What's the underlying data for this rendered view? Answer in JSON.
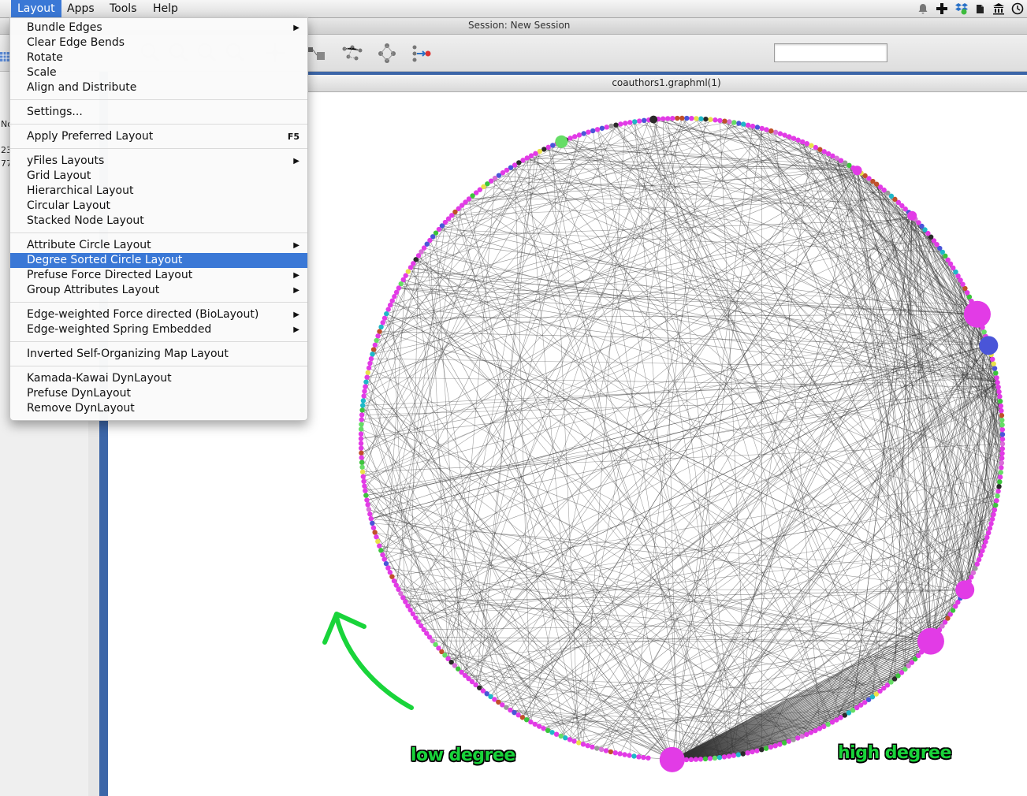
{
  "menubar": {
    "items": [
      "Layout",
      "Apps",
      "Tools",
      "Help"
    ],
    "active": "Layout",
    "tray_icons": [
      "bell-icon",
      "plus-cross-icon",
      "dropbox-icon",
      "evernote-icon",
      "museum-icon",
      "timemachine-icon"
    ]
  },
  "window": {
    "session_title": "Session: New Session",
    "network_title": "coauthors1.graphml(1)"
  },
  "left_panel": {
    "header_fragment": "No",
    "row1_fragment": "23",
    "row2_fragment": "77"
  },
  "layout_menu": {
    "items": [
      {
        "label": "Bundle Edges",
        "submenu": true
      },
      {
        "label": "Clear Edge Bends"
      },
      {
        "label": "Rotate"
      },
      {
        "label": "Scale"
      },
      {
        "label": "Align and Distribute"
      },
      {
        "label": "Settings..."
      },
      {
        "label": "Apply Preferred Layout",
        "shortcut": "F5"
      },
      {
        "label": "yFiles Layouts",
        "submenu": true
      },
      {
        "label": "Grid Layout"
      },
      {
        "label": "Hierarchical Layout"
      },
      {
        "label": "Circular Layout"
      },
      {
        "label": "Stacked Node Layout"
      },
      {
        "label": "Attribute Circle Layout",
        "submenu": true
      },
      {
        "label": "Degree Sorted Circle Layout",
        "selected": true
      },
      {
        "label": "Prefuse Force Directed Layout",
        "submenu": true
      },
      {
        "label": "Group Attributes Layout",
        "submenu": true
      },
      {
        "label": "Edge-weighted Force directed (BioLayout)",
        "submenu": true
      },
      {
        "label": "Edge-weighted Spring Embedded",
        "submenu": true
      },
      {
        "label": "Inverted Self-Organizing Map Layout"
      },
      {
        "label": "Kamada-Kawai DynLayout"
      },
      {
        "label": "Prefuse DynLayout"
      },
      {
        "label": "Remove DynLayout"
      }
    ],
    "selected_color": "#3a78d6"
  },
  "annotations": {
    "low": "low degree",
    "high": "high degree",
    "color": "#19d43a"
  },
  "graph": {
    "node_colors": [
      "#e23be6",
      "#3cc43c",
      "#2a2a2a",
      "#4a55d8",
      "#e8e24a",
      "#9a9a9a",
      "#1fb8c8",
      "#c0502a",
      "#d86fd8",
      "#66dd66"
    ],
    "edge_color": "#333333"
  }
}
